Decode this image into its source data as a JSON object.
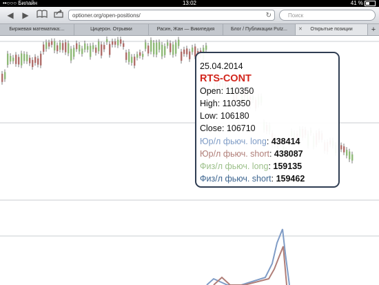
{
  "statusbar": {
    "carrier": "••○○○ Билайн",
    "time": "13:02",
    "battery": "41 %"
  },
  "toolbar": {
    "back_icon": "back-arrow-icon",
    "forward_icon": "forward-arrow-icon",
    "bookmarks_icon": "bookmarks-icon",
    "share_icon": "share-icon",
    "url": "optioner.org/open-positions/",
    "search_placeholder": "Поиск"
  },
  "tabs": [
    {
      "label": "Биржевая математика:..."
    },
    {
      "label": "Цицерон. Отрывки"
    },
    {
      "label": "Расин, Жан — Википедия"
    },
    {
      "label": "Блог / Публикации Putz..."
    },
    {
      "label": "Открытые позиции"
    }
  ],
  "tooltip": {
    "date": "25.04.2014",
    "symbol": "RTS-CONT",
    "open_label": "Open:",
    "open": "110350",
    "high_label": "High:",
    "high": "110350",
    "low_label": "Low:",
    "low": "106180",
    "close_label": "Close:",
    "close": "106710",
    "rows": [
      {
        "label": "Юр/л фьюч. long",
        "value": "438414",
        "color": "#7f9cc6"
      },
      {
        "label": "Юр/л фьюч. short",
        "value": "438087",
        "color": "#b07e78"
      },
      {
        "label": "Физ/л фьюч. long",
        "value": "159135",
        "color": "#9cc08a"
      },
      {
        "label": "Физ/л фьюч. short",
        "value": "159462",
        "color": "#3d6590"
      }
    ]
  },
  "colors": {
    "up_candle": "#8fba78",
    "down_candle": "#b06e6a",
    "tooltip_border": "#2f3d52",
    "symbol": "#d2251c"
  }
}
